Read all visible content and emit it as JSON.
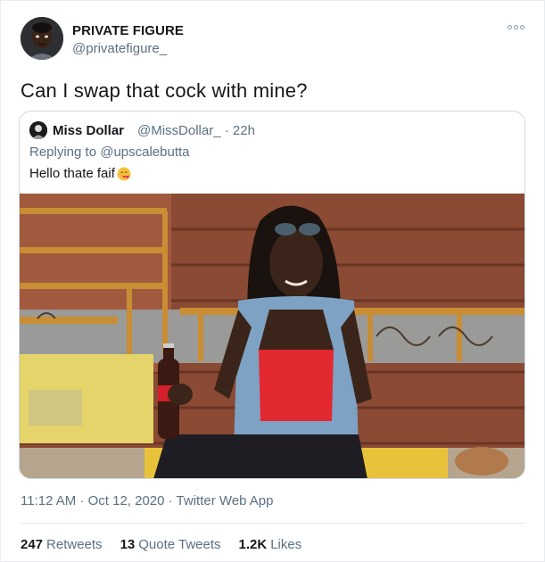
{
  "tweet": {
    "display_name": "PRIVATE FIGURE",
    "username": "@privatefigure_",
    "text": "Can I swap that cock with mine?",
    "timestamp": "11:12 AM · Oct 12, 2020 · Twitter Web App"
  },
  "quoted_tweet": {
    "display_name": "Miss Dollar",
    "username_time": "@MissDollar_ · 22h",
    "replying_to_prefix": "Replying to",
    "replying_to_handle": "@upscalebutta",
    "text": "Hello thate faif",
    "emoji": "kissing-face-icon"
  },
  "stats": {
    "retweets_count": "247",
    "retweets_label": "Retweets",
    "quote_count": "13",
    "quote_label": "Quote Tweets",
    "likes_count": "1.2K",
    "likes_label": "Likes"
  },
  "colors": {
    "secondary_text": "#5b7083",
    "border": "#cfd9de",
    "primary_text": "#14171a"
  }
}
